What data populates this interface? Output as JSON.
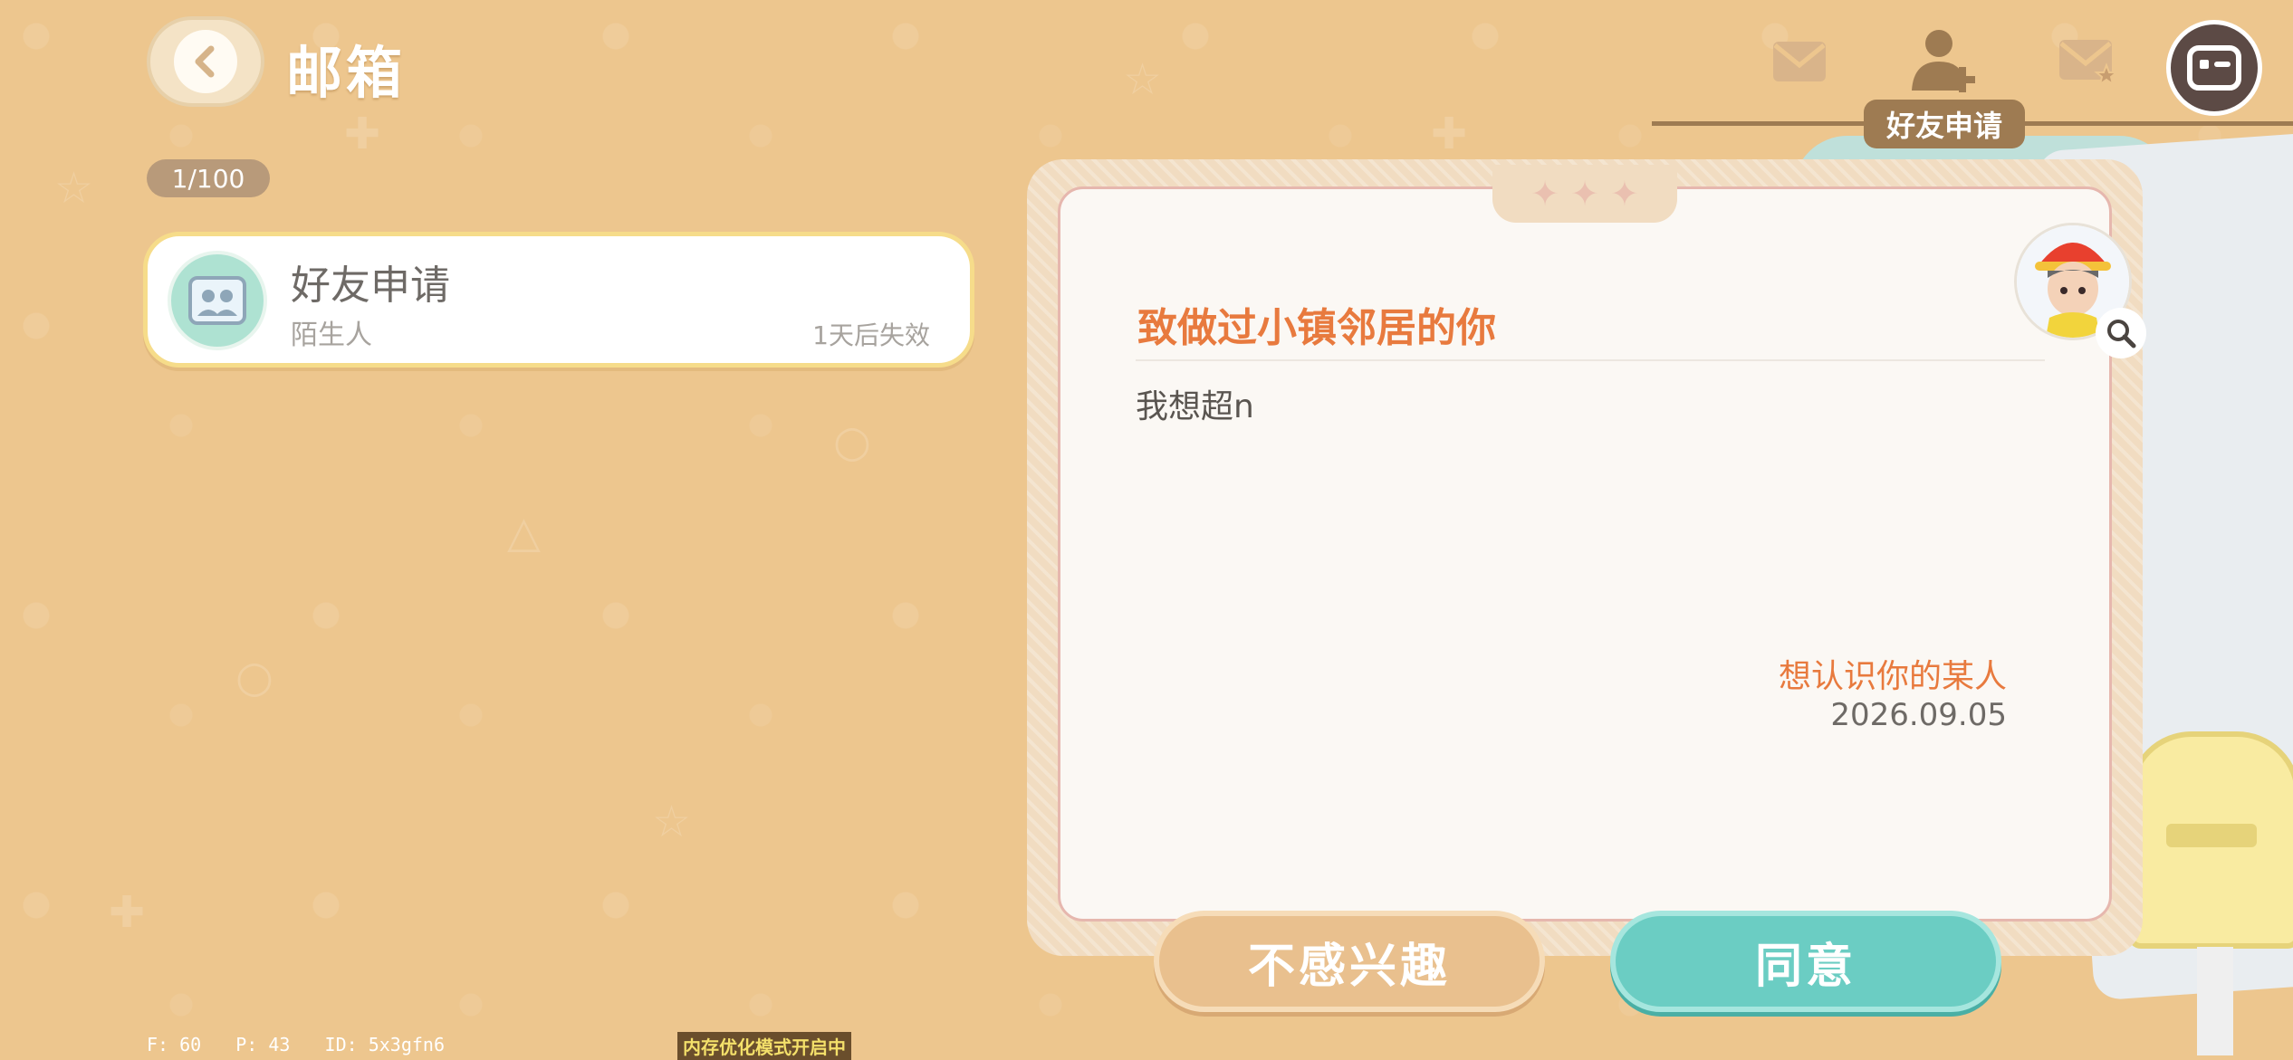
{
  "header": {
    "title": "邮箱",
    "counter": "1/100"
  },
  "tabs": {
    "active_label": "好友申请",
    "items": [
      {
        "icon": "envelope-icon"
      },
      {
        "icon": "add-friend-icon"
      },
      {
        "icon": "starred-envelope-icon"
      }
    ]
  },
  "mail_list": [
    {
      "icon": "friend-request-icon",
      "title": "好友申请",
      "subtitle": "陌生人",
      "expire": "1天后失效"
    }
  ],
  "letter": {
    "subject": "致做过小镇邻居的你",
    "body": "我想超n",
    "sender": "想认识你的某人",
    "date": "2026.09.05"
  },
  "actions": {
    "decline": "不感兴趣",
    "accept": "同意"
  },
  "footer": {
    "fps": "F: 60",
    "ping": "P: 43",
    "id": "ID: 5x3gfn6",
    "notice": "内存优化模式开启中"
  },
  "colors": {
    "background": "#EDC68E",
    "accent_orange": "#E87A3E",
    "accept_teal": "#6BCDC3",
    "decline_tan": "#E9C08E"
  }
}
